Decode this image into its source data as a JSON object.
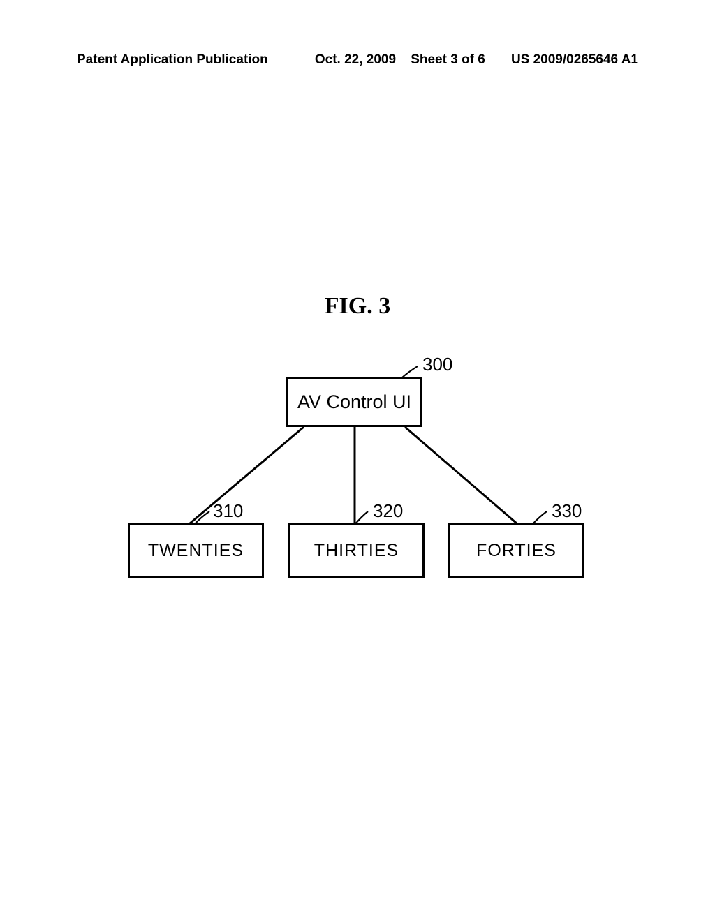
{
  "header": {
    "publication": "Patent Application Publication",
    "date": "Oct. 22, 2009",
    "sheet": "Sheet 3 of 6",
    "docnum": "US 2009/0265646 A1"
  },
  "figure": {
    "title": "FIG.  3"
  },
  "diagram": {
    "root": {
      "label": "AV Control UI",
      "ref": "300"
    },
    "children": [
      {
        "label": "TWENTIES",
        "ref": "310"
      },
      {
        "label": "THIRTIES",
        "ref": "320"
      },
      {
        "label": "FORTIES",
        "ref": "330"
      }
    ]
  }
}
